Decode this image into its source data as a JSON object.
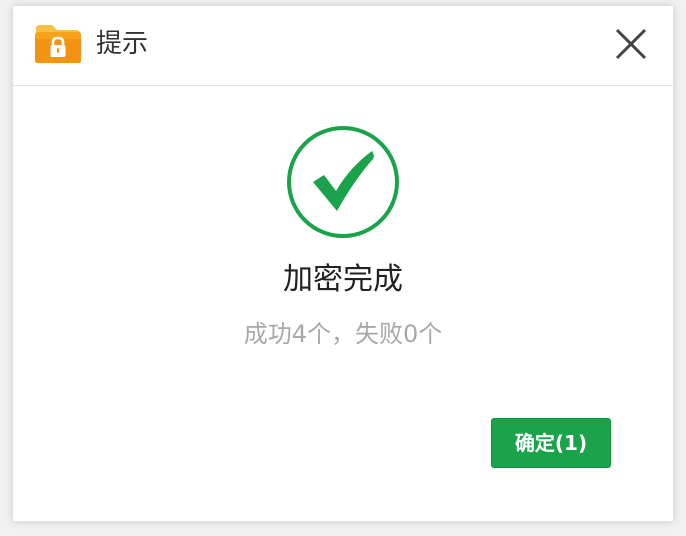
{
  "dialog": {
    "title": "提示",
    "heading": "加密完成",
    "result_text": "成功4个，失败0个",
    "ok_label": "确定(1)"
  },
  "icons": {
    "app": "encrypted-folder-icon",
    "close": "close-icon",
    "status": "success-check-circle-icon"
  },
  "colors": {
    "success": "#1aa34a",
    "folder": "#f7a21b",
    "heading": "#222222",
    "muted": "#a8a8a8"
  }
}
